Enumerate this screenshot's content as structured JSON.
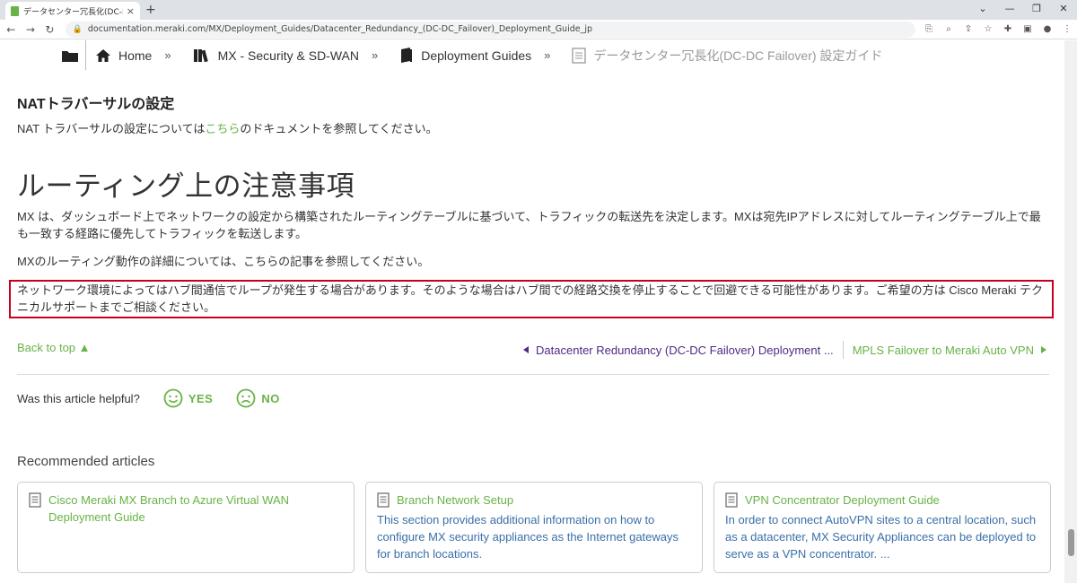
{
  "browser": {
    "tab_title": "データセンター冗長化(DC-DC Failov",
    "tab_close": "×",
    "new_tab": "+",
    "url": "documentation.meraki.com/MX/Deployment_Guides/Datacenter_Redundancy_(DC-DC_Failover)_Deployment_Guide_jp"
  },
  "breadcrumb": {
    "items": [
      {
        "label": "Home",
        "icon": "home-icon"
      },
      {
        "label": "MX - Security & SD-WAN",
        "icon": "books-icon"
      },
      {
        "label": "Deployment Guides",
        "icon": "book-icon"
      },
      {
        "label": "データセンター冗長化(DC-DC Failover) 設定ガイド",
        "icon": "page-icon"
      }
    ],
    "separator": "»"
  },
  "article": {
    "nat_heading": "NATトラバーサルの設定",
    "nat_text_before": "NAT トラバーサルの設定については",
    "nat_link": "こちら",
    "nat_text_after": "のドキュメントを参照してください。",
    "routing_heading": "ルーティング上の注意事項",
    "routing_p1": "MX は、ダッシュボード上でネットワークの設定から構築されたルーティングテーブルに基づいて、トラフィックの転送先を決定します。MXは宛先IPアドレスに対してルーティングテーブル上で最も一致する経路に優先してトラフィックを転送します。",
    "routing_p2": "MXのルーティング動作の詳細については、こちらの記事を参照してください。",
    "callout": "ネットワーク環境によってはハブ間通信でループが発生する場合があります。そのような場合はハブ間での経路交換を停止することで回避できる可能性があります。ご希望の方は Cisco Meraki テクニカルサポートまでご相談ください。"
  },
  "footer_nav": {
    "back_to_top": "Back to top ▲",
    "prev": "Datacenter Redundancy (DC-DC Failover) Deployment ...",
    "next": "MPLS Failover to Meraki Auto VPN"
  },
  "feedback": {
    "question": "Was this article helpful?",
    "yes": "YES",
    "no": "NO"
  },
  "recommended": {
    "title": "Recommended articles",
    "cards": [
      {
        "title": "Cisco Meraki MX Branch to Azure Virtual WAN Deployment Guide",
        "desc": ""
      },
      {
        "title": "Branch Network Setup",
        "desc": "This section provides additional information on how to configure MX security appliances as the Internet gateways for branch locations."
      },
      {
        "title": "VPN Concentrator Deployment Guide",
        "desc": "In order to connect AutoVPN sites to a central location, such as a datacenter, MX Security Appliances can be deployed to serve as a VPN concentrator. ..."
      }
    ]
  },
  "colors": {
    "brand_green": "#67b346",
    "prev_link": "#4e2a84",
    "callout_border": "#c8001e",
    "desc_blue": "#3a6fa8"
  }
}
